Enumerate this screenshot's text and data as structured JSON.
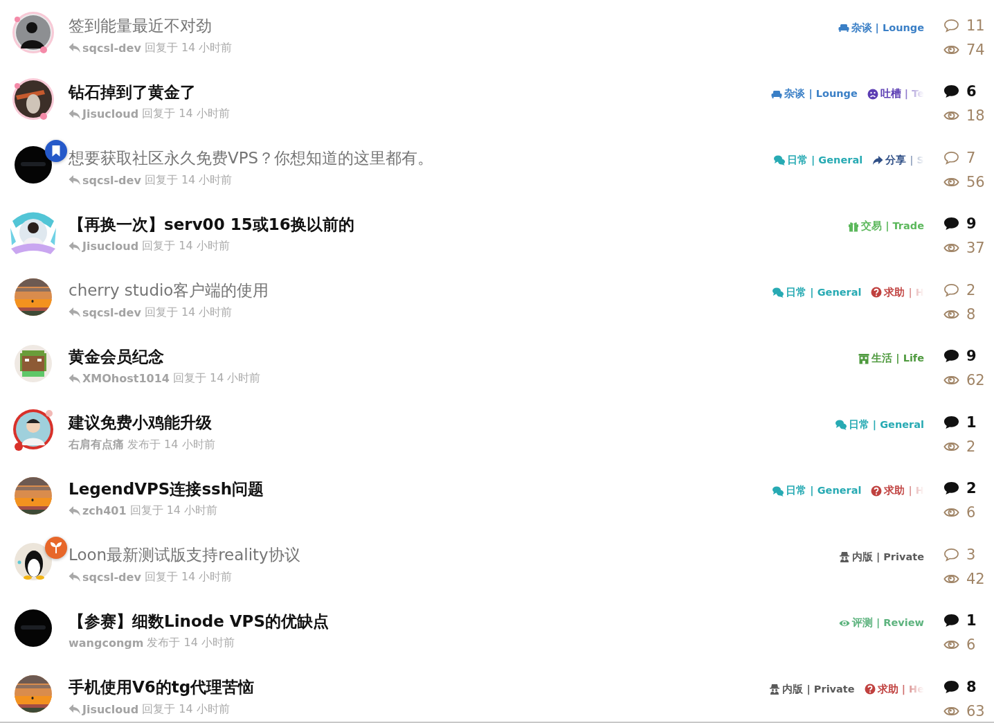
{
  "topics": [
    {
      "title": "签到能量最近不对劲",
      "unread": false,
      "meta": {
        "kind": "reply",
        "user": "sqcsl-dev",
        "text": "回复于 14 小时前"
      },
      "tags": [
        {
          "kind": "sofa",
          "label": "杂谈 | Lounge",
          "color": "#3a7fc6",
          "faded": false
        }
      ],
      "replies": "11",
      "views": "74"
    },
    {
      "title": "钻石掉到了黄金了",
      "unread": true,
      "meta": {
        "kind": "reply",
        "user": "Jisucloud",
        "text": "回复于 14 小时前"
      },
      "tags": [
        {
          "kind": "sofa",
          "label": "杂谈 | Lounge",
          "color": "#3a7fc6",
          "faded": false
        },
        {
          "kind": "frown",
          "label": "吐槽 | Te",
          "color": "#5b3db3",
          "faded": true
        }
      ],
      "replies": "6",
      "views": "18"
    },
    {
      "title": "想要获取社区永久免费VPS？你想知道的这里都有。",
      "unread": false,
      "badge": {
        "kind": "bookmark"
      },
      "meta": {
        "kind": "reply",
        "user": "sqcsl-dev",
        "text": "回复于 14 小时前"
      },
      "tags": [
        {
          "kind": "chat",
          "label": "日常 | General",
          "color": "#27aab3",
          "faded": false
        },
        {
          "kind": "share",
          "label": "分享 | S",
          "color": "#2f4f86",
          "faded": true
        }
      ],
      "replies": "7",
      "views": "56"
    },
    {
      "title": "【再换一次】serv00 15或16换以前的",
      "unread": true,
      "meta": {
        "kind": "reply",
        "user": "Jisucloud",
        "text": "回复于 14 小时前"
      },
      "tags": [
        {
          "kind": "gift",
          "label": "交易 | Trade",
          "color": "#5cb85c",
          "faded": false
        }
      ],
      "replies": "9",
      "views": "37"
    },
    {
      "title": "cherry studio客户端的使用",
      "unread": false,
      "meta": {
        "kind": "reply",
        "user": "sqcsl-dev",
        "text": "回复于 14 小时前"
      },
      "tags": [
        {
          "kind": "chat",
          "label": "日常 | General",
          "color": "#27aab3",
          "faded": false
        },
        {
          "kind": "question",
          "label": "求助 | H",
          "color": "#c0413f",
          "faded": true
        }
      ],
      "replies": "2",
      "views": "8"
    },
    {
      "title": "黄金会员纪念",
      "unread": true,
      "meta": {
        "kind": "reply",
        "user": "XMOhost1014",
        "text": "回复于 14 小时前"
      },
      "tags": [
        {
          "kind": "building",
          "label": "生活 | Life",
          "color": "#4f9a3f",
          "faded": false
        }
      ],
      "replies": "9",
      "views": "62"
    },
    {
      "title": "建议免费小鸡能升级",
      "unread": true,
      "meta": {
        "kind": "posted",
        "user": "右肩有点痛",
        "text": "发布于 14 小时前"
      },
      "tags": [
        {
          "kind": "chat",
          "label": "日常 | General",
          "color": "#27aab3",
          "faded": false
        }
      ],
      "replies": "1",
      "views": "2"
    },
    {
      "title": "LegendVPS连接ssh问题",
      "unread": true,
      "meta": {
        "kind": "reply",
        "user": "zch401",
        "text": "回复于 14 小时前"
      },
      "tags": [
        {
          "kind": "chat",
          "label": "日常 | General",
          "color": "#27aab3",
          "faded": false
        },
        {
          "kind": "question",
          "label": "求助 | H",
          "color": "#c0413f",
          "faded": true
        }
      ],
      "replies": "2",
      "views": "6"
    },
    {
      "title": "Loon最新测试版支持reality协议",
      "unread": false,
      "badge": {
        "kind": "sprout"
      },
      "meta": {
        "kind": "reply",
        "user": "sqcsl-dev",
        "text": "回复于 14 小时前"
      },
      "tags": [
        {
          "kind": "spy",
          "label": "内版 | Private",
          "color": "#5a5a5a",
          "faded": false
        }
      ],
      "replies": "3",
      "views": "42"
    },
    {
      "title": "【参赛】细数Linode VPS的优缺点",
      "unread": true,
      "meta": {
        "kind": "posted",
        "user": "wangcongm",
        "text": "发布于 14 小时前"
      },
      "tags": [
        {
          "kind": "eye",
          "label": "评测 | Review",
          "color": "#5db37e",
          "faded": false
        }
      ],
      "replies": "1",
      "views": "6"
    },
    {
      "title": "手机使用V6的tg代理苦恼",
      "unread": true,
      "meta": {
        "kind": "reply",
        "user": "Jisucloud",
        "text": "回复于 14 小时前"
      },
      "tags": [
        {
          "kind": "spy",
          "label": "内版 | Private",
          "color": "#5a5a5a",
          "faded": false
        },
        {
          "kind": "question",
          "label": "求助 | He",
          "color": "#c0413f",
          "faded": true
        }
      ],
      "replies": "8",
      "views": "63"
    }
  ]
}
